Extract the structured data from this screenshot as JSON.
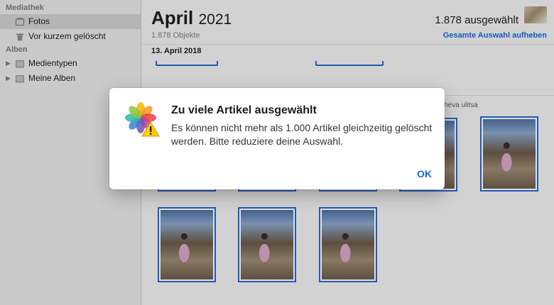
{
  "sidebar": {
    "library_header": "Mediathek",
    "library_items": [
      {
        "label": "Fotos",
        "icon": "photos-library-icon",
        "selected": true
      },
      {
        "label": "Vor kurzem gelöscht",
        "icon": "trash-icon",
        "selected": false
      }
    ],
    "albums_header": "Alben",
    "album_folders": [
      {
        "label": "Medientypen",
        "icon": "folder-icon"
      },
      {
        "label": "Meine Alben",
        "icon": "folder-icon"
      }
    ]
  },
  "header": {
    "month": "April",
    "year": "2021",
    "object_count": "1.878 Objekte",
    "selected_count": "1.878 ausgewählt",
    "deselect_all": "Gesamte Auswahl aufheben"
  },
  "content": {
    "date_heading": "13. April 2018",
    "location_label": "sheva ulitsa"
  },
  "dialog": {
    "title": "Zu viele Artikel ausgewählt",
    "message": "Es können nicht mehr als 1.000 Artikel gleichzeitig gelöscht werden. Bitte reduziere deine Auswahl.",
    "ok_label": "OK",
    "icon": "photos-warning-icon"
  },
  "colors": {
    "accent": "#1a66d6",
    "selection_border": "#2866d0",
    "sidebar_bg": "#e6e6e6"
  }
}
